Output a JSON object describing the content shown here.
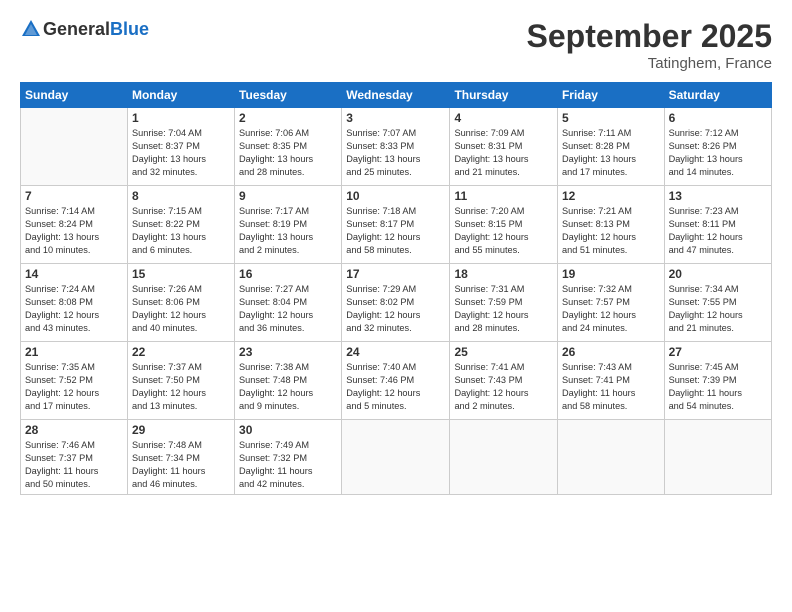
{
  "header": {
    "logo_general": "General",
    "logo_blue": "Blue",
    "month_title": "September 2025",
    "location": "Tatinghem, France"
  },
  "days_of_week": [
    "Sunday",
    "Monday",
    "Tuesday",
    "Wednesday",
    "Thursday",
    "Friday",
    "Saturday"
  ],
  "weeks": [
    [
      {
        "day": "",
        "info": ""
      },
      {
        "day": "1",
        "info": "Sunrise: 7:04 AM\nSunset: 8:37 PM\nDaylight: 13 hours\nand 32 minutes."
      },
      {
        "day": "2",
        "info": "Sunrise: 7:06 AM\nSunset: 8:35 PM\nDaylight: 13 hours\nand 28 minutes."
      },
      {
        "day": "3",
        "info": "Sunrise: 7:07 AM\nSunset: 8:33 PM\nDaylight: 13 hours\nand 25 minutes."
      },
      {
        "day": "4",
        "info": "Sunrise: 7:09 AM\nSunset: 8:31 PM\nDaylight: 13 hours\nand 21 minutes."
      },
      {
        "day": "5",
        "info": "Sunrise: 7:11 AM\nSunset: 8:28 PM\nDaylight: 13 hours\nand 17 minutes."
      },
      {
        "day": "6",
        "info": "Sunrise: 7:12 AM\nSunset: 8:26 PM\nDaylight: 13 hours\nand 14 minutes."
      }
    ],
    [
      {
        "day": "7",
        "info": "Sunrise: 7:14 AM\nSunset: 8:24 PM\nDaylight: 13 hours\nand 10 minutes."
      },
      {
        "day": "8",
        "info": "Sunrise: 7:15 AM\nSunset: 8:22 PM\nDaylight: 13 hours\nand 6 minutes."
      },
      {
        "day": "9",
        "info": "Sunrise: 7:17 AM\nSunset: 8:19 PM\nDaylight: 13 hours\nand 2 minutes."
      },
      {
        "day": "10",
        "info": "Sunrise: 7:18 AM\nSunset: 8:17 PM\nDaylight: 12 hours\nand 58 minutes."
      },
      {
        "day": "11",
        "info": "Sunrise: 7:20 AM\nSunset: 8:15 PM\nDaylight: 12 hours\nand 55 minutes."
      },
      {
        "day": "12",
        "info": "Sunrise: 7:21 AM\nSunset: 8:13 PM\nDaylight: 12 hours\nand 51 minutes."
      },
      {
        "day": "13",
        "info": "Sunrise: 7:23 AM\nSunset: 8:11 PM\nDaylight: 12 hours\nand 47 minutes."
      }
    ],
    [
      {
        "day": "14",
        "info": "Sunrise: 7:24 AM\nSunset: 8:08 PM\nDaylight: 12 hours\nand 43 minutes."
      },
      {
        "day": "15",
        "info": "Sunrise: 7:26 AM\nSunset: 8:06 PM\nDaylight: 12 hours\nand 40 minutes."
      },
      {
        "day": "16",
        "info": "Sunrise: 7:27 AM\nSunset: 8:04 PM\nDaylight: 12 hours\nand 36 minutes."
      },
      {
        "day": "17",
        "info": "Sunrise: 7:29 AM\nSunset: 8:02 PM\nDaylight: 12 hours\nand 32 minutes."
      },
      {
        "day": "18",
        "info": "Sunrise: 7:31 AM\nSunset: 7:59 PM\nDaylight: 12 hours\nand 28 minutes."
      },
      {
        "day": "19",
        "info": "Sunrise: 7:32 AM\nSunset: 7:57 PM\nDaylight: 12 hours\nand 24 minutes."
      },
      {
        "day": "20",
        "info": "Sunrise: 7:34 AM\nSunset: 7:55 PM\nDaylight: 12 hours\nand 21 minutes."
      }
    ],
    [
      {
        "day": "21",
        "info": "Sunrise: 7:35 AM\nSunset: 7:52 PM\nDaylight: 12 hours\nand 17 minutes."
      },
      {
        "day": "22",
        "info": "Sunrise: 7:37 AM\nSunset: 7:50 PM\nDaylight: 12 hours\nand 13 minutes."
      },
      {
        "day": "23",
        "info": "Sunrise: 7:38 AM\nSunset: 7:48 PM\nDaylight: 12 hours\nand 9 minutes."
      },
      {
        "day": "24",
        "info": "Sunrise: 7:40 AM\nSunset: 7:46 PM\nDaylight: 12 hours\nand 5 minutes."
      },
      {
        "day": "25",
        "info": "Sunrise: 7:41 AM\nSunset: 7:43 PM\nDaylight: 12 hours\nand 2 minutes."
      },
      {
        "day": "26",
        "info": "Sunrise: 7:43 AM\nSunset: 7:41 PM\nDaylight: 11 hours\nand 58 minutes."
      },
      {
        "day": "27",
        "info": "Sunrise: 7:45 AM\nSunset: 7:39 PM\nDaylight: 11 hours\nand 54 minutes."
      }
    ],
    [
      {
        "day": "28",
        "info": "Sunrise: 7:46 AM\nSunset: 7:37 PM\nDaylight: 11 hours\nand 50 minutes."
      },
      {
        "day": "29",
        "info": "Sunrise: 7:48 AM\nSunset: 7:34 PM\nDaylight: 11 hours\nand 46 minutes."
      },
      {
        "day": "30",
        "info": "Sunrise: 7:49 AM\nSunset: 7:32 PM\nDaylight: 11 hours\nand 42 minutes."
      },
      {
        "day": "",
        "info": ""
      },
      {
        "day": "",
        "info": ""
      },
      {
        "day": "",
        "info": ""
      },
      {
        "day": "",
        "info": ""
      }
    ]
  ]
}
